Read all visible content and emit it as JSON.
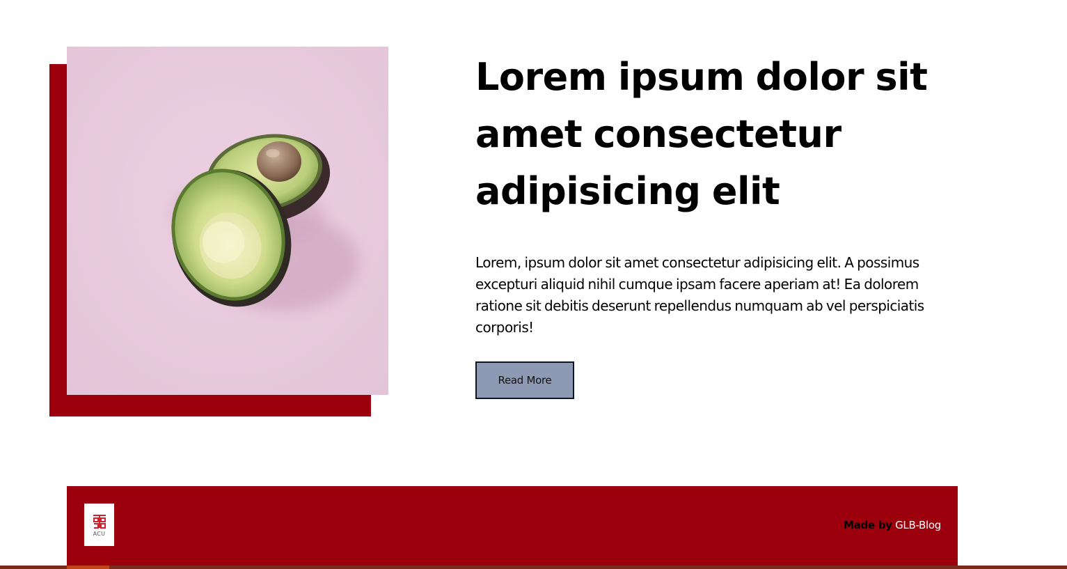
{
  "colors": {
    "accent": "#9b000c",
    "button_bg": "#8e9ab3",
    "image_bg": "#e8c9dc"
  },
  "hero": {
    "image_icon": "avocado-photo",
    "headline": "Lorem ipsum dolor sit amet consectetur adipisicing elit",
    "body": "Lorem, ipsum dolor sit amet consectetur adipisicing elit. A possimus excepturi aliquid nihil cumque ipsam facere aperiam at! Ea dolorem ratione sit debitis deserunt repellendus numquam ab vel perspiciatis corporis!",
    "button_label": "Read More"
  },
  "footer": {
    "logo_text": "ACU",
    "credit_label": "Made by",
    "credit_link": "GLB-Blog"
  }
}
